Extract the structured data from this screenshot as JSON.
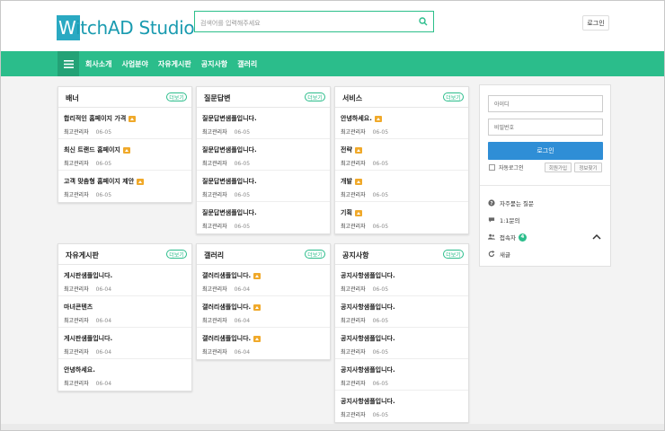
{
  "header": {
    "logo": "WitchAD Studio",
    "logo_first": "W",
    "logo_rest": "itchAD Studio",
    "search_placeholder": "검색어를 입력해주세요",
    "login_button": "로그인"
  },
  "nav": {
    "items": [
      "회사소개",
      "사업분야",
      "자유게시판",
      "공지사항",
      "갤러리"
    ]
  },
  "more_label": "더보기",
  "cards": {
    "banner": {
      "title": "배너",
      "items": [
        {
          "title": "합리적인 홈페이지 가격",
          "author": "최고관리자",
          "date": "06-05",
          "img": true
        },
        {
          "title": "최신 트랜드 홈페이지",
          "author": "최고관리자",
          "date": "06-05",
          "img": true
        },
        {
          "title": "고객 맞춤형 홈페이지 제안",
          "author": "최고관리자",
          "date": "06-05",
          "img": true
        }
      ]
    },
    "qna": {
      "title": "질문답변",
      "items": [
        {
          "title": "질문답변샘플입니다.",
          "author": "최고관리자",
          "date": "06-05"
        },
        {
          "title": "질문답변샘플입니다.",
          "author": "최고관리자",
          "date": "06-05"
        },
        {
          "title": "질문답변샘플입니다.",
          "author": "최고관리자",
          "date": "06-05"
        },
        {
          "title": "질문답변샘플입니다.",
          "author": "최고관리자",
          "date": "06-05"
        }
      ]
    },
    "service": {
      "title": "서비스",
      "items": [
        {
          "title": "안녕하세요.",
          "author": "최고관리자",
          "date": "06-05",
          "img": true
        },
        {
          "title": "전략",
          "author": "최고관리자",
          "date": "06-05",
          "img": true
        },
        {
          "title": "개발",
          "author": "최고관리자",
          "date": "06-05",
          "img": true
        },
        {
          "title": "기획",
          "author": "최고관리자",
          "date": "06-05",
          "img": true
        }
      ]
    },
    "free": {
      "title": "자유게시판",
      "items": [
        {
          "title": "게시판샘플입니다.",
          "author": "최고관리자",
          "date": "06-04"
        },
        {
          "title": "마녀콘텐츠",
          "author": "최고관리자",
          "date": "06-04"
        },
        {
          "title": "게시판샘플입니다.",
          "author": "최고관리자",
          "date": "06-04"
        },
        {
          "title": "안녕하세요.",
          "author": "최고관리자",
          "date": "06-04"
        }
      ]
    },
    "gallery": {
      "title": "갤러리",
      "items": [
        {
          "title": "갤러리샘플입니다.",
          "author": "최고관리자",
          "date": "06-04",
          "img": true
        },
        {
          "title": "갤러리샘플입니다.",
          "author": "최고관리자",
          "date": "06-04",
          "img": true
        },
        {
          "title": "갤러리샘플입니다.",
          "author": "최고관리자",
          "date": "06-04",
          "img": true
        }
      ]
    },
    "notice": {
      "title": "공지사항",
      "items": [
        {
          "title": "공지사항샘플입니다.",
          "author": "최고관리자",
          "date": "06-05"
        },
        {
          "title": "공지사항샘플입니다.",
          "author": "최고관리자",
          "date": "06-05"
        },
        {
          "title": "공지사항샘플입니다.",
          "author": "최고관리자",
          "date": "06-05"
        },
        {
          "title": "공지사항샘플입니다.",
          "author": "최고관리자",
          "date": "06-05"
        },
        {
          "title": "공지사항샘플입니다.",
          "author": "최고관리자",
          "date": "06-05"
        }
      ]
    }
  },
  "sidebar": {
    "id_placeholder": "아이디",
    "pw_placeholder": "비밀번호",
    "login": "로그인",
    "auto_login": "자동로그인",
    "join": "회원가입",
    "find": "정보찾기",
    "links": {
      "faq": "자주묻는 질문",
      "qa": "1:1문의",
      "visitors": "접속자",
      "visitor_count": "4",
      "new": "새글"
    }
  },
  "colors": {
    "accent": "#2bbd8b",
    "login_button": "#2f8ed6",
    "logo": "#2aa9c2",
    "image_badge": "#f0a92a"
  }
}
